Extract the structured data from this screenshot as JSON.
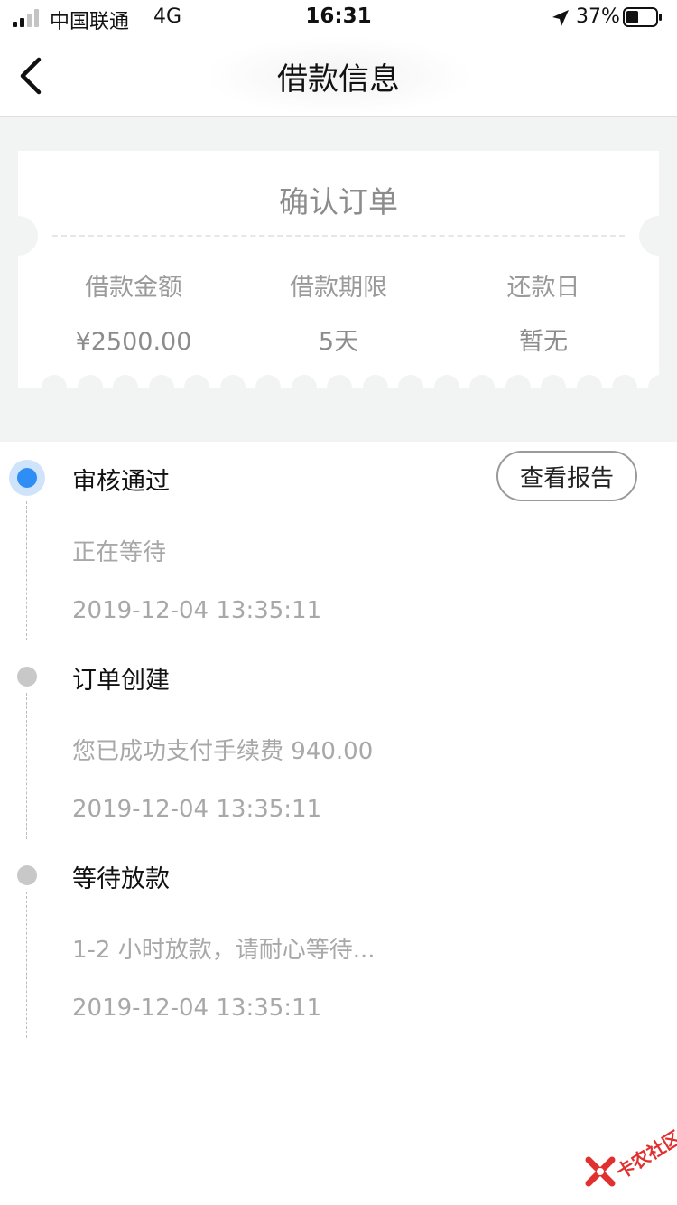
{
  "status_bar": {
    "carrier": "中国联通",
    "network": "4G",
    "time": "16:31",
    "battery_percent": "37%",
    "icons": [
      "signal-icon",
      "location-arrow-icon",
      "battery-icon"
    ]
  },
  "nav": {
    "title": "借款信息",
    "back_icon": "chevron-left-icon"
  },
  "ticket": {
    "title": "确认订单",
    "columns": [
      {
        "label": "借款金额",
        "value": "¥2500.00"
      },
      {
        "label": "借款期限",
        "value": "5天"
      },
      {
        "label": "还款日",
        "value": "暂无"
      }
    ]
  },
  "timeline": {
    "report_button_label": "查看报告",
    "items": [
      {
        "title": "审核通过",
        "desc": "正在等待",
        "time": "2019-12-04 13:35:11",
        "active": true
      },
      {
        "title": "订单创建",
        "desc": "您已成功支付手续费 940.00",
        "time": "2019-12-04 13:35:11",
        "active": false
      },
      {
        "title": "等待放款",
        "desc": "1-2 小时放款，请耐心等待...",
        "time": "2019-12-04 13:35:11",
        "active": false
      }
    ]
  },
  "watermark": {
    "text": "卡农社区",
    "color": "#e03030"
  },
  "colors": {
    "accent": "#2f8ef5",
    "accent_halo": "#cfe4fb",
    "section_bg": "#f2f3f3"
  }
}
